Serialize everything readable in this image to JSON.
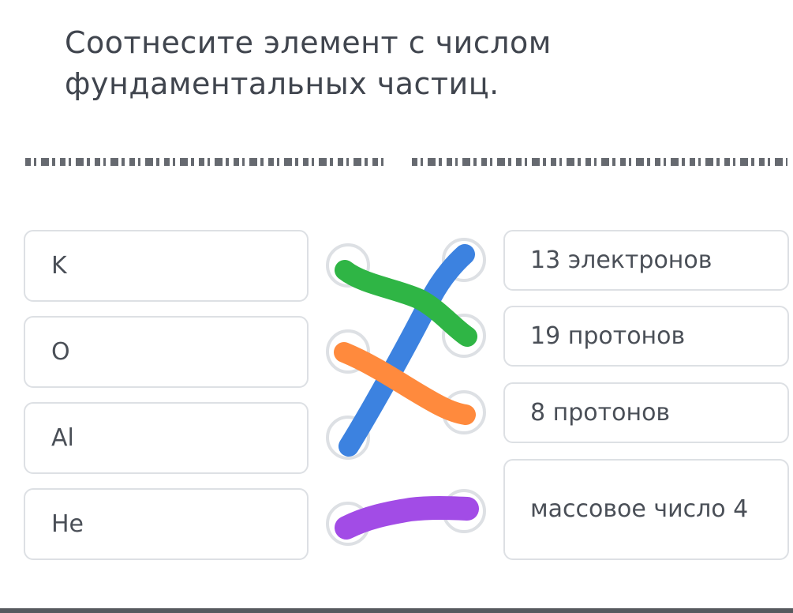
{
  "question": {
    "title": "Соотнесите элемент с числом фундаментальных частиц."
  },
  "left_items": [
    {
      "label": "K"
    },
    {
      "label": "O"
    },
    {
      "label": "Al"
    },
    {
      "label": "He"
    }
  ],
  "right_items": [
    {
      "label": "13 электронов"
    },
    {
      "label": "19 протонов"
    },
    {
      "label": "8 протонов"
    },
    {
      "label": "массовое число 4"
    }
  ],
  "connections": [
    {
      "from": "K",
      "to": "19 протонов",
      "color": "#2fb545"
    },
    {
      "from": "O",
      "to": "8 протонов",
      "color": "#ff8a3d"
    },
    {
      "from": "Al",
      "to": "13 электронов",
      "color": "#3c82e0"
    },
    {
      "from": "He",
      "to": "массовое число 4",
      "color": "#a24ce6"
    }
  ],
  "colors": {
    "card_border": "#dde0e4",
    "text": "#4a4f57"
  }
}
